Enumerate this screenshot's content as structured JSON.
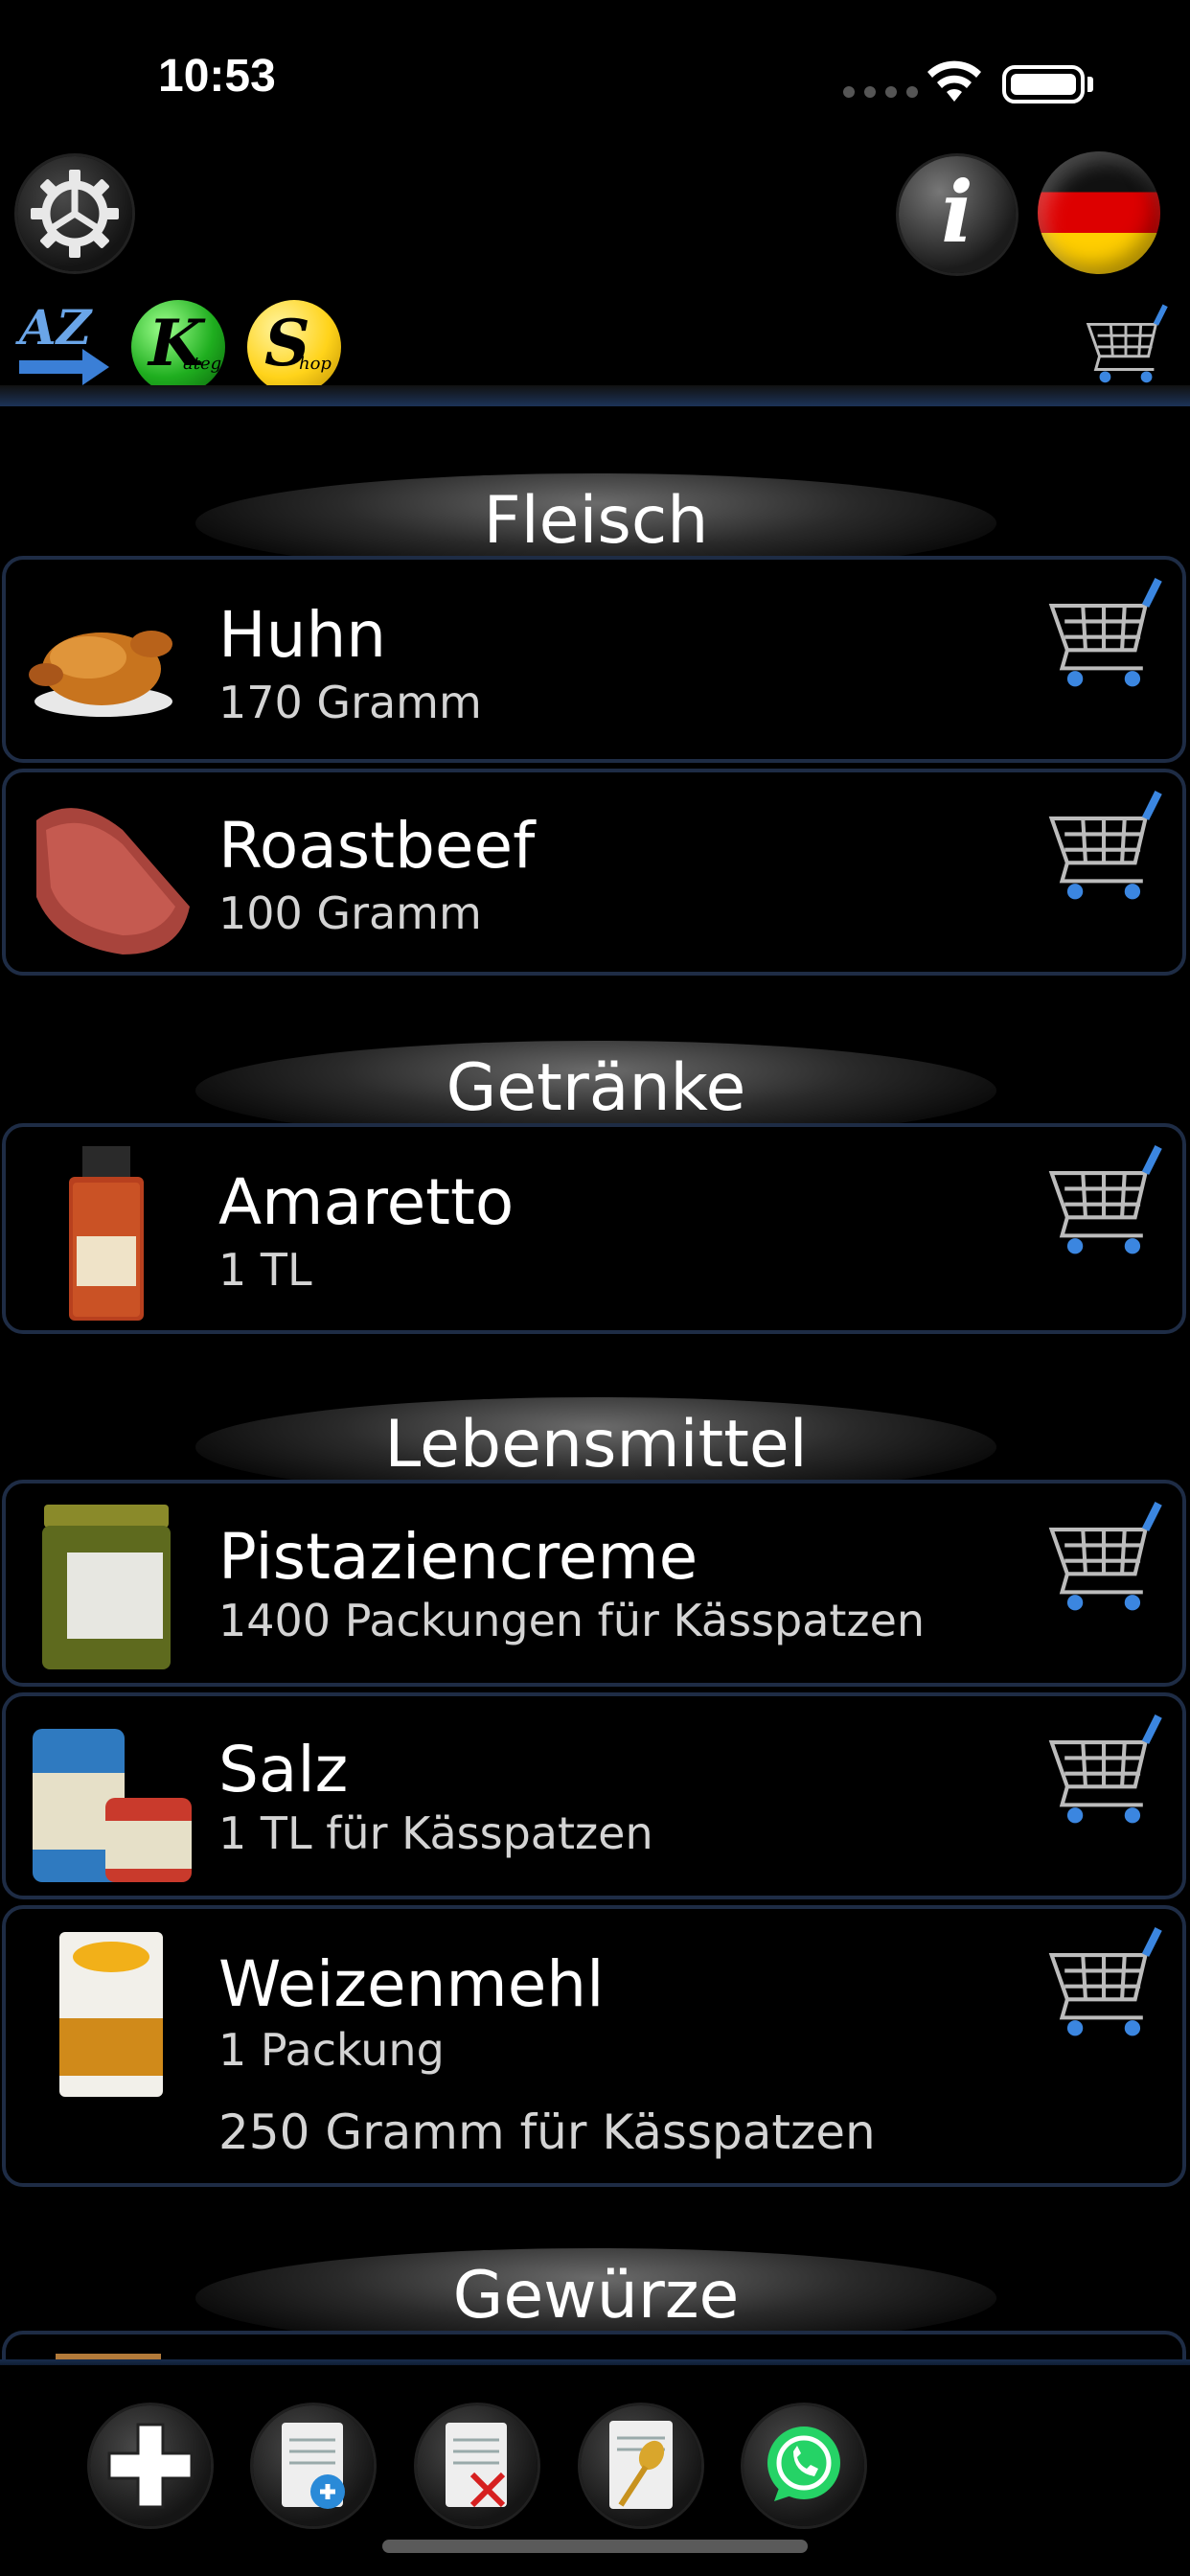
{
  "status_bar": {
    "time": "10:53"
  },
  "toolbar": {
    "settings_icon": "gear-icon",
    "info_icon": "info-icon",
    "info_glyph": "i",
    "language_icon": "german-flag-icon",
    "sort_az_label": "AZ",
    "category_badge": {
      "letter": "K",
      "small": "ateg."
    },
    "shop_badge": {
      "letter": "S",
      "small": "hop"
    }
  },
  "sections": [
    {
      "title": "Fleisch",
      "items": [
        {
          "name": "Huhn",
          "lines": [
            "170 Gramm"
          ],
          "thumb": "chicken"
        },
        {
          "name": "Roastbeef",
          "lines": [
            "100 Gramm"
          ],
          "thumb": "beef"
        }
      ]
    },
    {
      "title": "Getränke",
      "items": [
        {
          "name": "Amaretto",
          "lines": [
            "1 TL"
          ],
          "thumb": "bottle"
        }
      ]
    },
    {
      "title": "Lebensmittel",
      "items": [
        {
          "name": "Pistaziencreme",
          "lines": [
            "1400 Packungen für Kässpatzen"
          ],
          "thumb": "jar"
        },
        {
          "name": "Salz",
          "lines": [
            "1 TL für Kässpatzen"
          ],
          "thumb": "salt"
        },
        {
          "name": "Weizenmehl",
          "lines": [
            "1 Packung",
            "250 Gramm für Kässpatzen"
          ],
          "thumb": "flour"
        }
      ]
    },
    {
      "title": "Gewürze",
      "items": []
    }
  ],
  "bottom_toolbar": [
    "add-icon",
    "add-list-icon",
    "delete-list-icon",
    "recipe-icon",
    "whatsapp-icon"
  ],
  "colors": {
    "accent_blue": "#1e2c45",
    "whatsapp_green": "#25d366"
  }
}
